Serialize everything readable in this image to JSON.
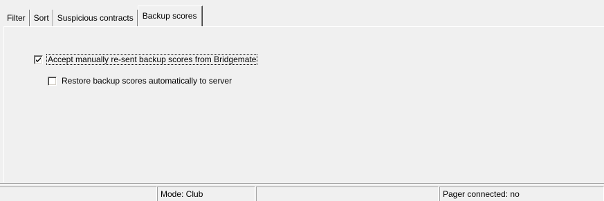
{
  "tabs": [
    {
      "label": "Filter",
      "active": false
    },
    {
      "label": "Sort",
      "active": false
    },
    {
      "label": "Suspicious contracts",
      "active": false
    },
    {
      "label": "Backup scores",
      "active": true
    }
  ],
  "options": {
    "accept_resent": {
      "label": "Accept manually re-sent backup scores from Bridgemate",
      "checked": true
    },
    "restore_auto": {
      "label": "Restore backup scores automatically to server",
      "checked": false
    }
  },
  "statusbar": {
    "panel1": "",
    "mode": "Mode: Club",
    "panel3": "",
    "pager": "Pager connected: no"
  }
}
